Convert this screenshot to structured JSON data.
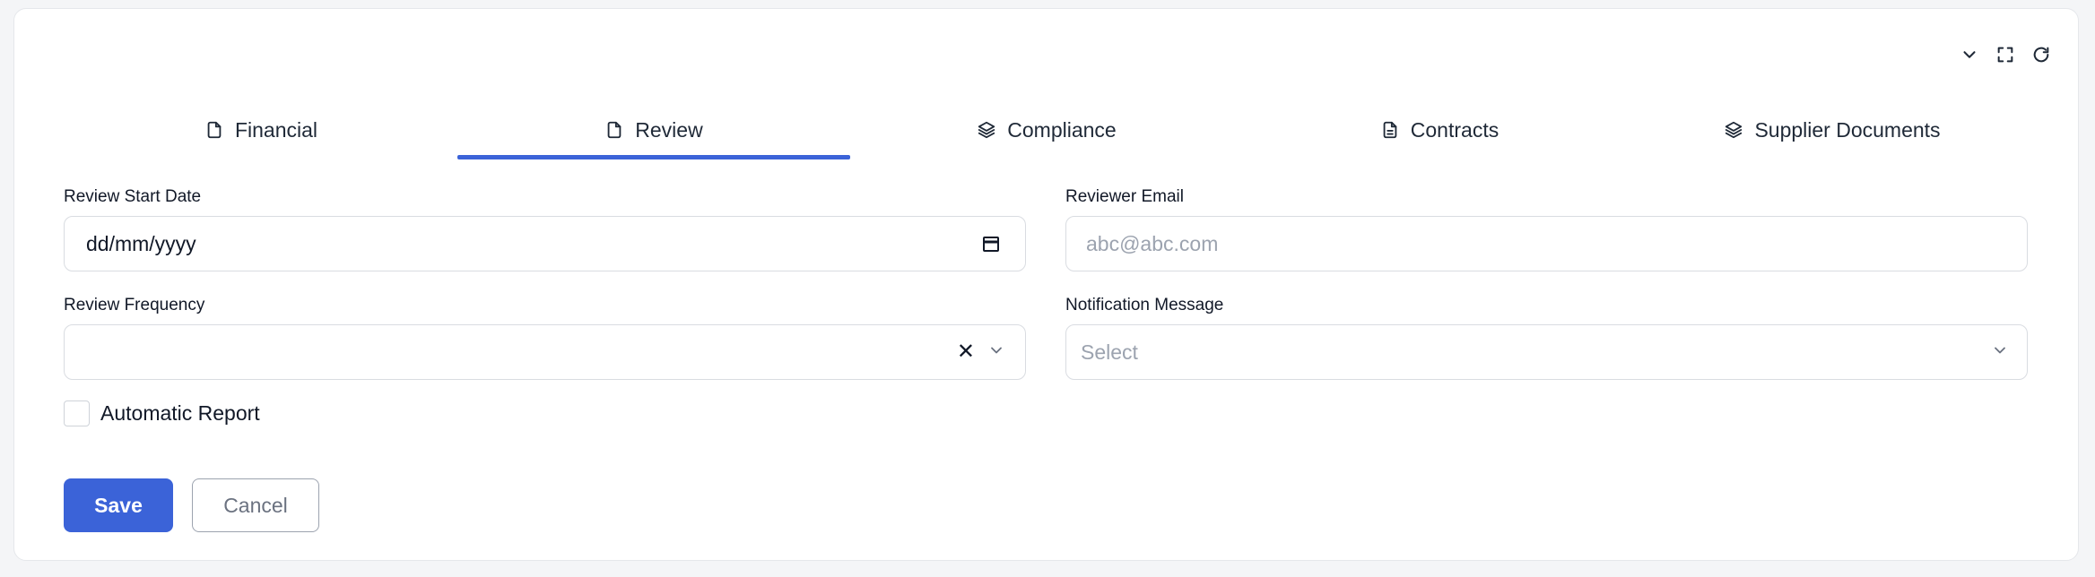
{
  "toolbar": {
    "collapse_icon": "chevron-down-icon",
    "fullscreen_icon": "expand-icon",
    "refresh_icon": "refresh-icon"
  },
  "tabs": [
    {
      "label": "Financial",
      "icon": "file-icon",
      "active": false
    },
    {
      "label": "Review",
      "icon": "file-icon",
      "active": true
    },
    {
      "label": "Compliance",
      "icon": "layers-icon",
      "active": false
    },
    {
      "label": "Contracts",
      "icon": "file-text-icon",
      "active": false
    },
    {
      "label": "Supplier Documents",
      "icon": "layers-icon",
      "active": false
    }
  ],
  "form": {
    "review_start_date": {
      "label": "Review Start Date",
      "value": "dd/mm/yyyy"
    },
    "reviewer_email": {
      "label": "Reviewer Email",
      "placeholder": "abc@abc.com",
      "value": ""
    },
    "review_frequency": {
      "label": "Review Frequency",
      "value": ""
    },
    "notification_message": {
      "label": "Notification Message",
      "placeholder": "Select"
    },
    "automatic_report": {
      "label": "Automatic Report",
      "checked": false
    }
  },
  "actions": {
    "save_label": "Save",
    "cancel_label": "Cancel"
  },
  "colors": {
    "accent": "#3b63d8"
  }
}
